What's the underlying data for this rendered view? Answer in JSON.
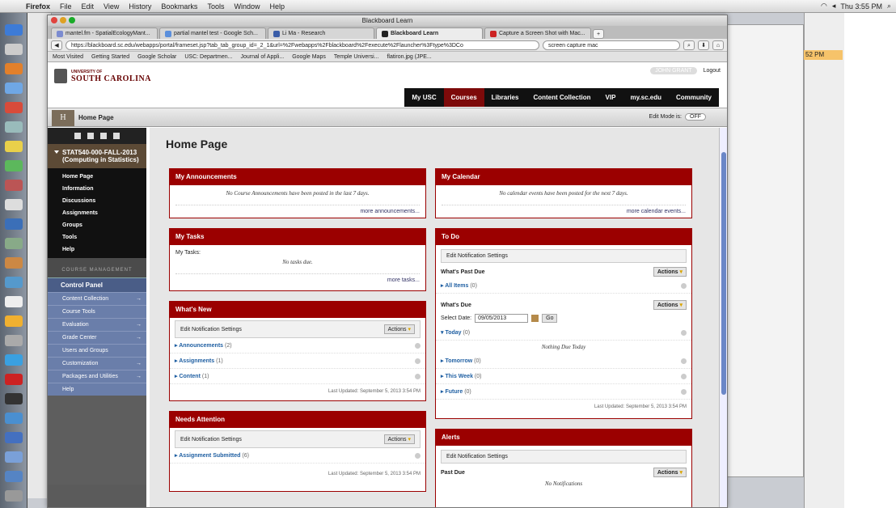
{
  "menubar": {
    "app": "Firefox",
    "items": [
      "File",
      "Edit",
      "View",
      "History",
      "Bookmarks",
      "Tools",
      "Window",
      "Help"
    ],
    "clock": "Thu 3:55 PM"
  },
  "window": {
    "title": "Blackboard Learn",
    "tabs": [
      {
        "label": "mantel.fm - SpatialEcologyMant...",
        "color": "#7b8bd0"
      },
      {
        "label": "partial mantel test - Google Sch...",
        "color": "#5b8fdc"
      },
      {
        "label": "Li Ma - Research",
        "color": "#3a5da8"
      },
      {
        "label": "Blackboard Learn",
        "color": "#222222"
      },
      {
        "label": "Capture a Screen Shot with Mac...",
        "color": "#cc2222"
      }
    ],
    "url": "https://blackboard.sc.edu/webapps/portal/frameset.jsp?tab_tab_group_id=_2_1&url=%2Fwebapps%2Fblackboard%2Fexecute%2Flauncher%3Ftype%3DCo",
    "search": "screen capture mac",
    "bookmarks": [
      "Most Visited",
      "Getting Started",
      "Google Scholar",
      "USC: Departmen...",
      "Journal of Appli...",
      "Google Maps",
      "Temple Universi...",
      "flatiron.jpg (JPE..."
    ]
  },
  "header": {
    "logo_small": "UNIVERSITY OF",
    "logo_big": "SOUTH CAROLINA",
    "user": "JOHN GRANT",
    "logout": "Logout",
    "nav": [
      "My USC",
      "Courses",
      "Libraries",
      "Content Collection",
      "VIP",
      "my.sc.edu",
      "Community"
    ],
    "active_nav": "Courses"
  },
  "breadcrumb": {
    "logo_letter": "H",
    "crumb": "Home Page",
    "edit_mode_label": "Edit Mode is:",
    "edit_mode_value": "OFF"
  },
  "course_menu": {
    "title": "STAT540-000-FALL-2013 (Computing in Statistics)",
    "links": [
      "Home Page",
      "Information",
      "Discussions",
      "Assignments",
      "Groups",
      "Tools",
      "Help"
    ],
    "management_label": "COURSE MANAGEMENT",
    "control_panel": "Control Panel",
    "cp_items": [
      "Content Collection",
      "Course Tools",
      "Evaluation",
      "Grade Center",
      "Users and Groups",
      "Customization",
      "Packages and Utilities",
      "Help"
    ]
  },
  "content": {
    "page_title": "Home Page",
    "announcements": {
      "title": "My Announcements",
      "empty": "No Course Announcements have been posted in the last 7 days.",
      "more": "more announcements..."
    },
    "calendar": {
      "title": "My Calendar",
      "empty": "No calendar events have been posted for the next 7 days.",
      "more": "more calendar events..."
    },
    "tasks": {
      "title": "My Tasks",
      "label": "My Tasks:",
      "empty": "No tasks due.",
      "more": "more tasks..."
    },
    "whats_new": {
      "title": "What's New",
      "notif": "Edit Notification Settings",
      "actions": "Actions",
      "rows": [
        {
          "label": "Announcements",
          "count": "(2)"
        },
        {
          "label": "Assignments",
          "count": "(1)"
        },
        {
          "label": "Content",
          "count": "(1)"
        }
      ],
      "updated": "Last Updated: September 5, 2013 3:54 PM"
    },
    "needs_attention": {
      "title": "Needs Attention",
      "notif": "Edit Notification Settings",
      "actions": "Actions",
      "rows": [
        {
          "label": "Assignment Submitted",
          "count": "(6)"
        }
      ],
      "updated": "Last Updated: September 5, 2013 3:54 PM"
    },
    "todo": {
      "title": "To Do",
      "notif": "Edit Notification Settings",
      "past_due": "What's Past Due",
      "actions": "Actions",
      "all_items": {
        "label": "All Items",
        "count": "(0)"
      },
      "whats_due": "What's Due",
      "select_date_label": "Select Date:",
      "select_date_value": "09/05/2013",
      "go": "Go",
      "today": {
        "label": "Today",
        "count": "(0)"
      },
      "nothing_due": "Nothing Due Today",
      "rows": [
        {
          "label": "Tomorrow",
          "count": "(0)"
        },
        {
          "label": "This Week",
          "count": "(0)"
        },
        {
          "label": "Future",
          "count": "(0)"
        }
      ],
      "updated": "Last Updated: September 5, 2013 3:54 PM"
    },
    "alerts": {
      "title": "Alerts",
      "notif": "Edit Notification Settings",
      "past_due": "Past Due",
      "actions": "Actions",
      "empty": "No Notifications"
    }
  },
  "background": {
    "time_chip": "52 PM"
  }
}
